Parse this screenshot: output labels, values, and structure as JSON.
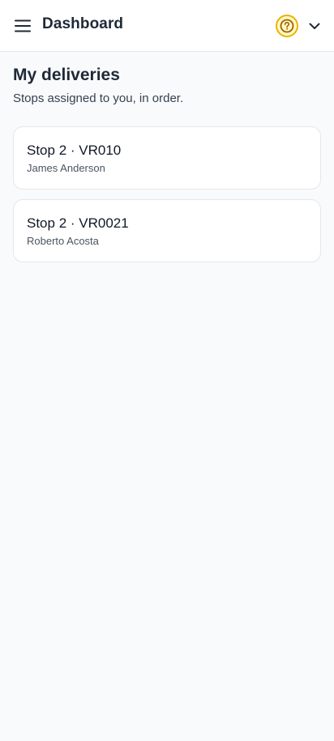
{
  "header": {
    "title": "Dashboard",
    "menu_icon": "hamburger-menu-icon",
    "help_icon": "question-circle-icon",
    "dropdown_icon": "chevron-down-icon",
    "help_accent": "#eab308"
  },
  "page": {
    "title": "My deliveries",
    "subtitle": "Stops assigned to you, in order."
  },
  "stops": [
    {
      "title": "Stop 2 · VR010",
      "customer": "James Anderson"
    },
    {
      "title": "Stop 2 · VR0021",
      "customer": "Roberto Acosta"
    }
  ]
}
